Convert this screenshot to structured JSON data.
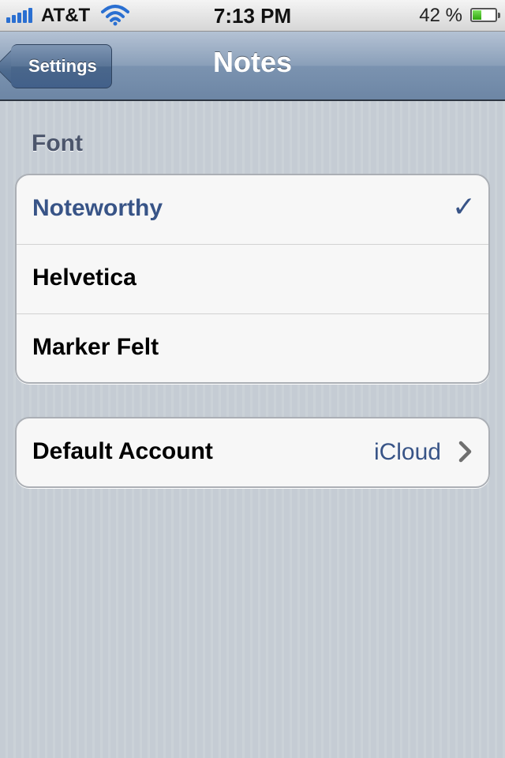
{
  "status_bar": {
    "carrier": "AT&T",
    "time": "7:13 PM",
    "battery_percent": "42 %",
    "battery_level": 0.42,
    "icons": [
      "signal-bars-icon",
      "wifi-icon",
      "battery-icon"
    ]
  },
  "nav": {
    "back_label": "Settings",
    "title": "Notes"
  },
  "font_section": {
    "header": "Font",
    "options": [
      {
        "label": "Noteworthy",
        "selected": true
      },
      {
        "label": "Helvetica",
        "selected": false
      },
      {
        "label": "Marker Felt",
        "selected": false
      }
    ],
    "checkmark": "✓"
  },
  "account_section": {
    "label": "Default Account",
    "value": "iCloud"
  },
  "colors": {
    "selected_text": "#385487",
    "nav_bar": "#6d86a5",
    "background": "#c5ccd4"
  }
}
